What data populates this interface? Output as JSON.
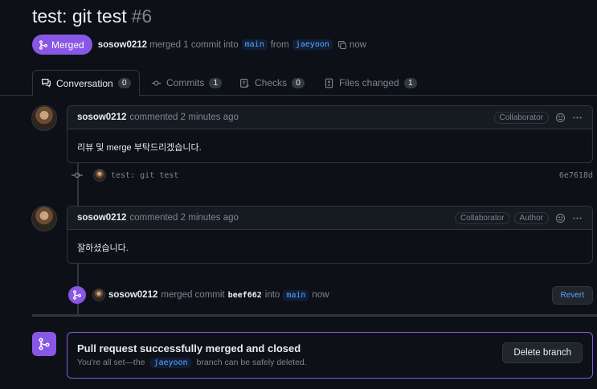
{
  "pr": {
    "title": "test: git test",
    "number": "#6",
    "state": "Merged",
    "author": "sosow0212",
    "merged_text": "merged 1 commit into",
    "base_branch": "main",
    "from_text": "from",
    "head_branch": "jaeyoon",
    "time": "now"
  },
  "tabs": [
    {
      "label": "Conversation",
      "count": "0",
      "icon": "comment-discussion-icon"
    },
    {
      "label": "Commits",
      "count": "1",
      "icon": "git-commit-icon"
    },
    {
      "label": "Checks",
      "count": "0",
      "icon": "checklist-icon"
    },
    {
      "label": "Files changed",
      "count": "1",
      "icon": "file-diff-icon"
    }
  ],
  "comments": [
    {
      "author": "sosow0212",
      "meta": "commented 2 minutes ago",
      "badges": [
        "Collaborator"
      ],
      "body": "리뷰 및 merge 부탁드리겠습니다."
    },
    {
      "author": "sosow0212",
      "meta": "commented 2 minutes ago",
      "badges": [
        "Collaborator",
        "Author"
      ],
      "body": "잘하셨습니다."
    }
  ],
  "commit": {
    "message": "test: git test",
    "sha": "6e7618d"
  },
  "merge_event": {
    "author": "sosow0212",
    "text1": "merged commit",
    "sha": "beef662",
    "text2": "into",
    "branch": "main",
    "time": "now",
    "revert_label": "Revert"
  },
  "merge_box": {
    "title": "Pull request successfully merged and closed",
    "sub_before": "You're all set—the",
    "branch": "jaeyoon",
    "sub_after": "branch can be safely deleted.",
    "delete_label": "Delete branch"
  },
  "colors": {
    "background": "#0d1117",
    "merged_purple": "#8957e5",
    "link_blue": "#58a6ff",
    "border": "#30363d",
    "muted": "#7d8590"
  }
}
